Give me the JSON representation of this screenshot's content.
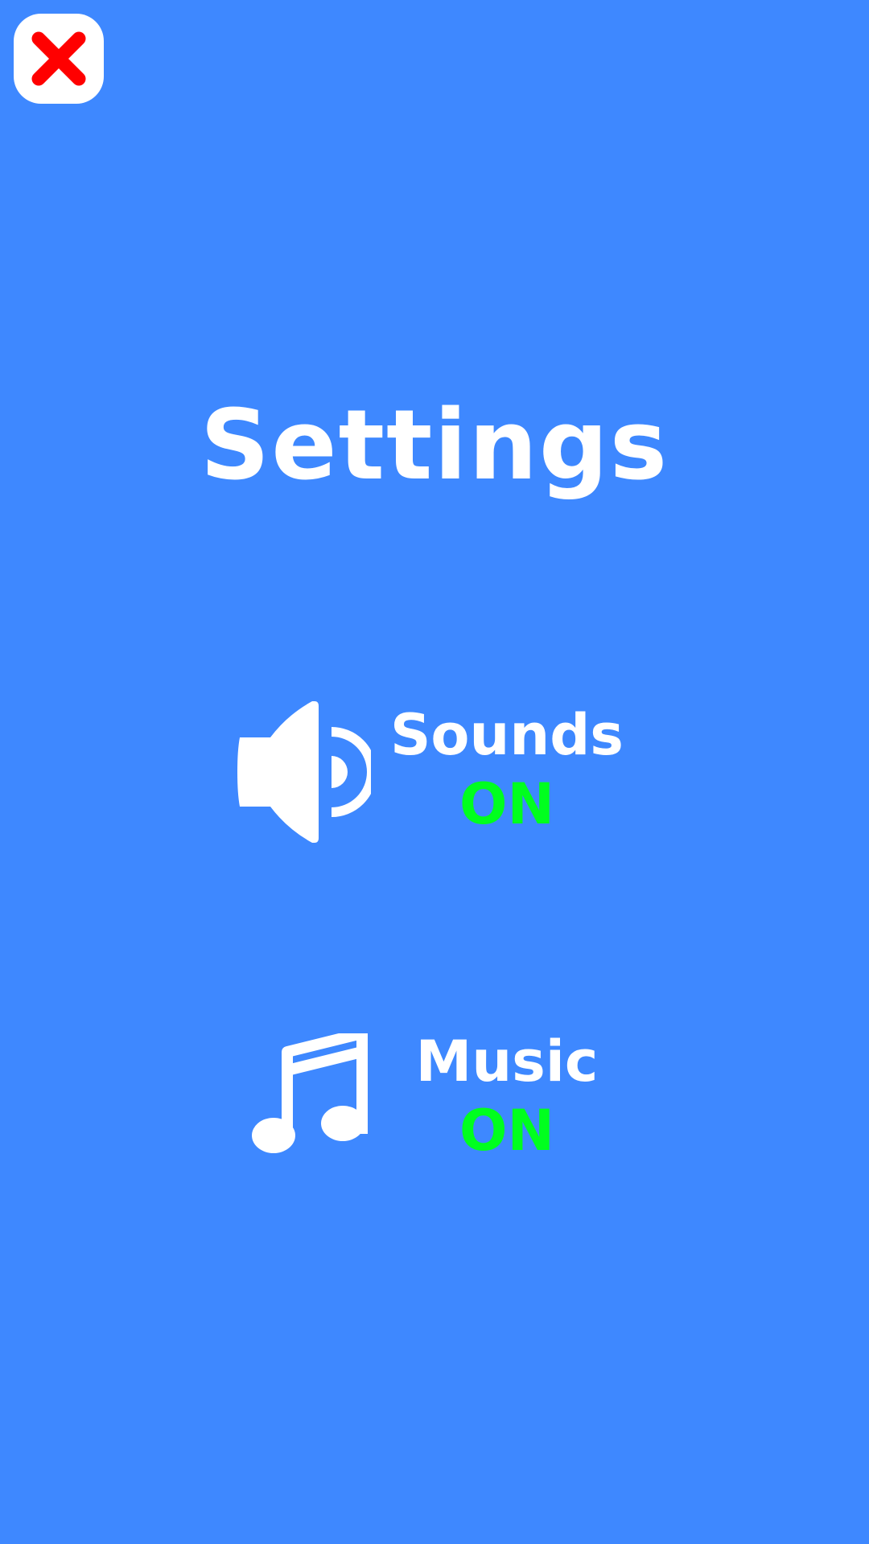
{
  "header": {
    "close_icon": "close-icon"
  },
  "title": "Settings",
  "settings": {
    "sounds": {
      "icon": "speaker-icon",
      "label": "Sounds",
      "state": "ON"
    },
    "music": {
      "icon": "music-note-icon",
      "label": "Music",
      "state": "ON"
    }
  },
  "colors": {
    "background": "#3e88ff",
    "text": "#ffffff",
    "state_on": "#00ff1e",
    "close_icon": "#ff0000"
  }
}
